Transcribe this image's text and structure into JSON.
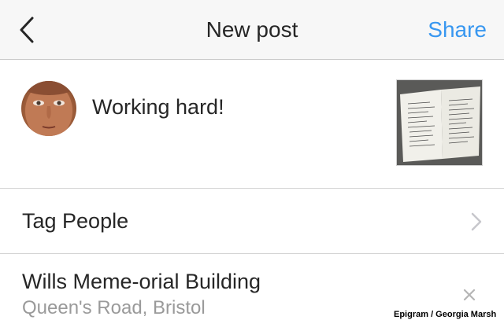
{
  "header": {
    "title": "New post",
    "share_label": "Share",
    "back_icon": "chevron-left-icon"
  },
  "compose": {
    "caption": "Working hard!",
    "avatar": "user-avatar",
    "thumbnail": "photo-thumbnail"
  },
  "tag_people": {
    "label": "Tag People",
    "icon": "chevron-right-icon"
  },
  "location": {
    "name": "Wills Meme-orial Building",
    "address": "Queen's Road, Bristol",
    "clear_icon": "close-icon"
  },
  "credit": "Epigram / Georgia Marsh",
  "colors": {
    "accent": "#3897f0",
    "text": "#262626",
    "secondary_text": "#9a9a9a",
    "header_bg": "#f7f7f7"
  }
}
